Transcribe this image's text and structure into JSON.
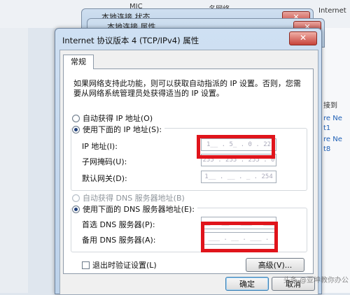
{
  "background": {
    "top_labels": [
      "MIC",
      " 名网络",
      "Internet"
    ],
    "side_links": [
      "接到",
      "re Ne",
      "t1",
      "re Ne",
      "t8"
    ],
    "window1_title": "本地连接 状态",
    "window2_title": "本地连接 属性",
    "close_glyph": "✕"
  },
  "dialog": {
    "title": "Internet 协议版本 4 (TCP/IPv4) 属性",
    "close_glyph": "✕",
    "tab_label": "常规",
    "description": "如果网络支持此功能，则可以获取自动指派的 IP 设置。否则，您需要从网络系统管理员处获得适当的 IP 设置。",
    "ip": {
      "auto_label": "自动获得 IP 地址(O)",
      "manual_label": "使用下面的 IP 地址(S):",
      "address_label": "IP 地址(I):",
      "address_value": "1__ . 5_ . 0 . 22",
      "mask_label": "子网掩码(U):",
      "mask_value": "255 . 255 . 255 . 0",
      "gateway_label": "默认网关(D):",
      "gateway_value": "1__ . __ . _ . 254"
    },
    "dns": {
      "auto_label": "自动获得 DNS 服务器地址(B)",
      "manual_label": "使用下面的 DNS 服务器地址(E):",
      "preferred_label": "首选 DNS 服务器(P):",
      "preferred_value": "__ . __ . ___ . ___",
      "alternate_label": "备用 DNS 服务器(A):",
      "alternate_value": "___ . __ . ___ . ___"
    },
    "validate_label": "退出时验证设置(L)",
    "advanced_label": "高级(V)...",
    "ok_label": "确定",
    "cancel_label": "取消"
  },
  "watermark": "头条 @亚坤教你办公",
  "colors": {
    "redaction": "#e0141b",
    "title_bar": "#bcd2ea"
  }
}
